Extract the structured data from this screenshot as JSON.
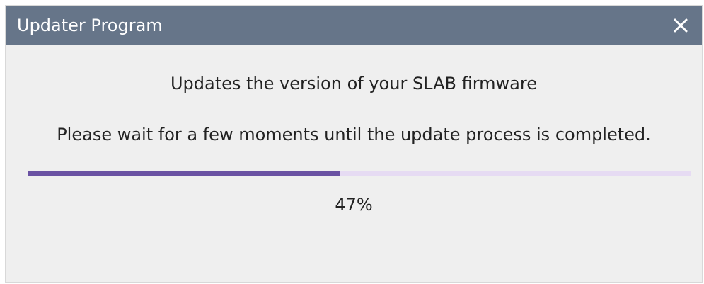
{
  "window": {
    "title": "Updater Program",
    "close_icon": "close-icon"
  },
  "content": {
    "headline": "Updates the version of your SLAB firmware",
    "message": "Please wait for a few moments until the update process is completed."
  },
  "progress": {
    "value": 0.47,
    "label": "47%",
    "fill_color": "#6a52a3",
    "track_color": "#e6dbf3"
  },
  "colors": {
    "titlebar": "#667589",
    "background": "#efefef"
  }
}
